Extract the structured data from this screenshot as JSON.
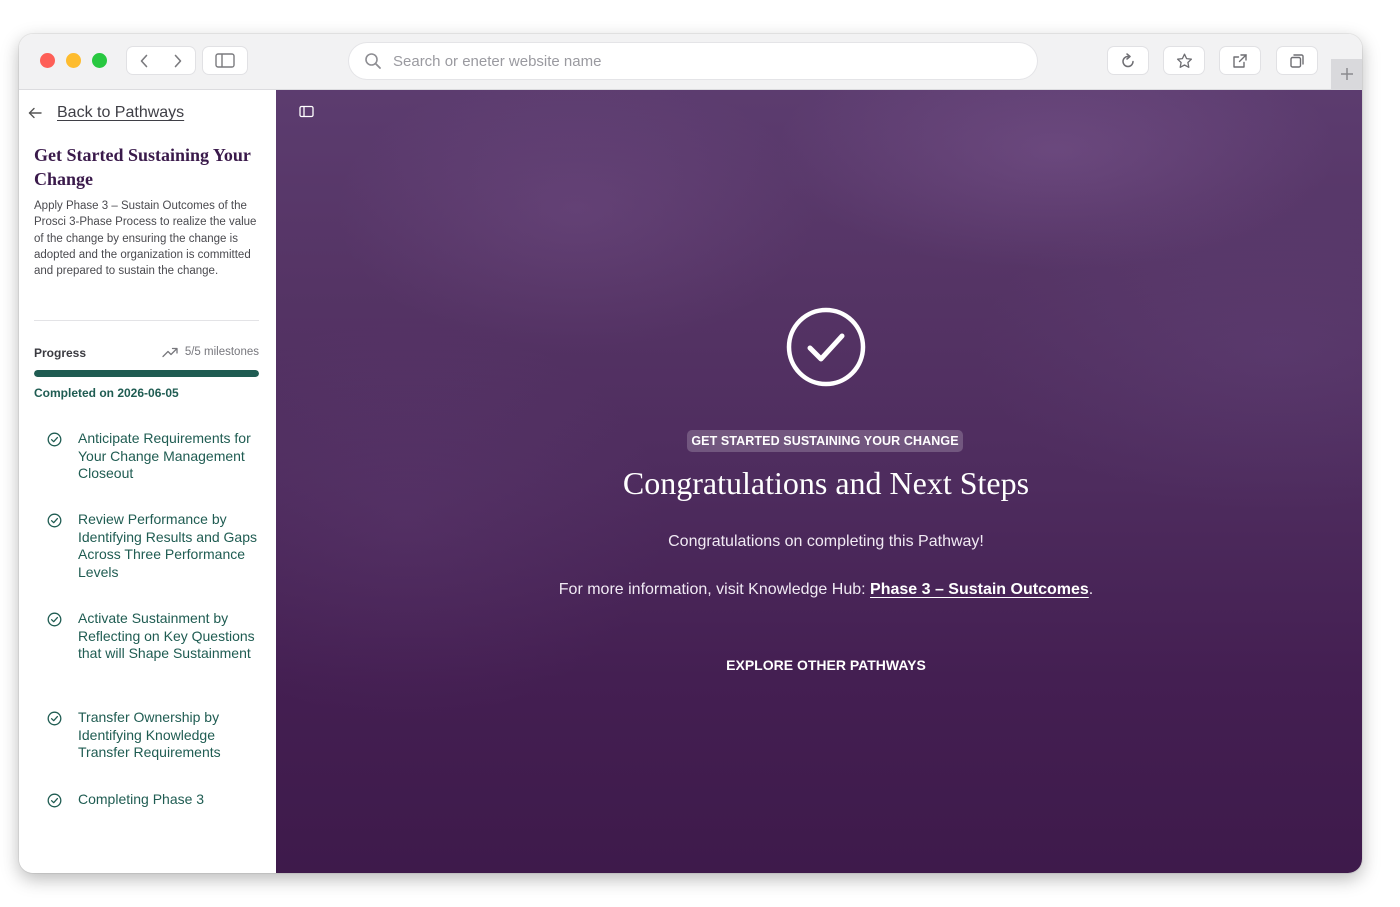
{
  "browser": {
    "address_placeholder": "Search or eneter website name"
  },
  "sidebar": {
    "back_label": "Back to Pathways",
    "title": "Get Started Sustaining Your Change",
    "description": "Apply Phase 3 – Sustain Outcomes of the Prosci 3-Phase Process to realize the value of the change by ensuring the change is adopted and the organization is committed and prepared to sustain the change.",
    "progress": {
      "label": "Progress",
      "milestones": "5/5 milestones",
      "fraction": 1.0,
      "completed_text": "Completed on 2026-06-05"
    },
    "steps": [
      {
        "label": "Anticipate Requirements for Your Change Management Closeout"
      },
      {
        "label": "Review Performance by Identifying Results and Gaps Across Three Performance Levels"
      },
      {
        "label": "Activate Sustainment by Reflecting on Key Questions that will Shape Sustainment"
      },
      {
        "label": "Transfer Ownership by Identifying Knowledge Transfer Requirements"
      },
      {
        "label": "Completing Phase 3"
      }
    ]
  },
  "main": {
    "badge": "GET STARTED SUSTAINING YOUR CHANGE",
    "heading": "Congratulations and Next Steps",
    "congrats_text": "Congratulations on completing this Pathway!",
    "info_prefix": "For more information, visit Knowledge Hub: ",
    "info_link": "Phase 3 – Sustain Outcomes",
    "info_suffix": ".",
    "explore_button": "EXPLORE OTHER PATHWAYS"
  },
  "colors": {
    "accent_green": "#1f5c52",
    "title_purple": "#3a1a4b",
    "main_background": "#4e2c5e"
  }
}
